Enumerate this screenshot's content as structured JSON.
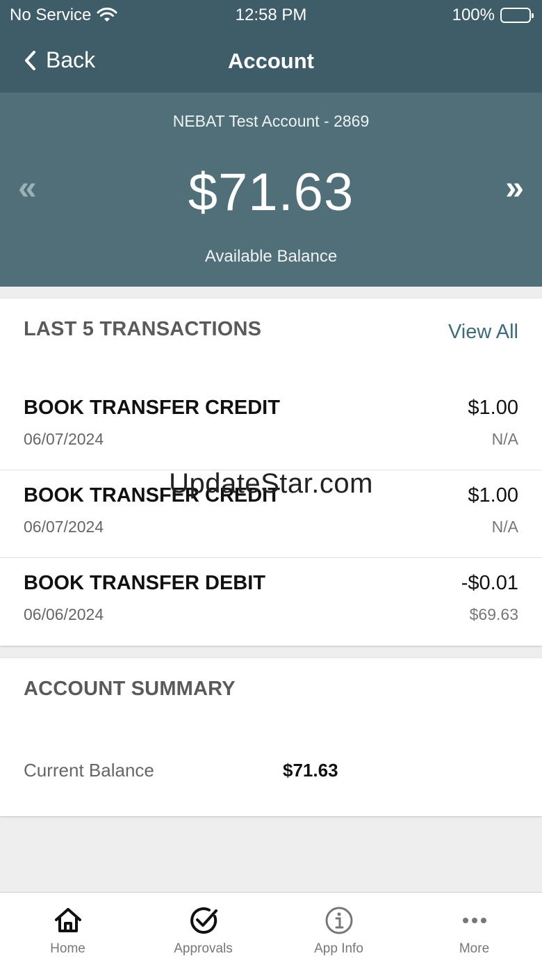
{
  "status_bar": {
    "carrier": "No Service",
    "time": "12:58 PM",
    "battery": "100%"
  },
  "nav": {
    "back_label": "Back",
    "title": "Account"
  },
  "account": {
    "name": "NEBAT Test Account - 2869",
    "balance": "$71.63",
    "balance_label": "Available Balance"
  },
  "transactions": {
    "title": "LAST 5 TRANSACTIONS",
    "view_all_label": "View All",
    "items": [
      {
        "name": "BOOK TRANSFER CREDIT",
        "date": "06/07/2024",
        "amount": "$1.00",
        "balance": "N/A"
      },
      {
        "name": "BOOK TRANSFER CREDIT",
        "date": "06/07/2024",
        "amount": "$1.00",
        "balance": "N/A"
      },
      {
        "name": "BOOK TRANSFER DEBIT",
        "date": "06/06/2024",
        "amount": "-$0.01",
        "balance": "$69.63"
      }
    ]
  },
  "summary": {
    "title": "ACCOUNT SUMMARY",
    "current_balance_label": "Current Balance",
    "current_balance_value": "$71.63"
  },
  "watermark": "UpdateStar.com",
  "tabs": [
    {
      "label": "Home",
      "icon": "home-icon"
    },
    {
      "label": "Approvals",
      "icon": "check-circle-icon"
    },
    {
      "label": "App Info",
      "icon": "info-icon"
    },
    {
      "label": "More",
      "icon": "more-icon"
    }
  ],
  "colors": {
    "header": "#3e5d68",
    "balance_bg": "#506f79",
    "link": "#3e6a7a"
  }
}
